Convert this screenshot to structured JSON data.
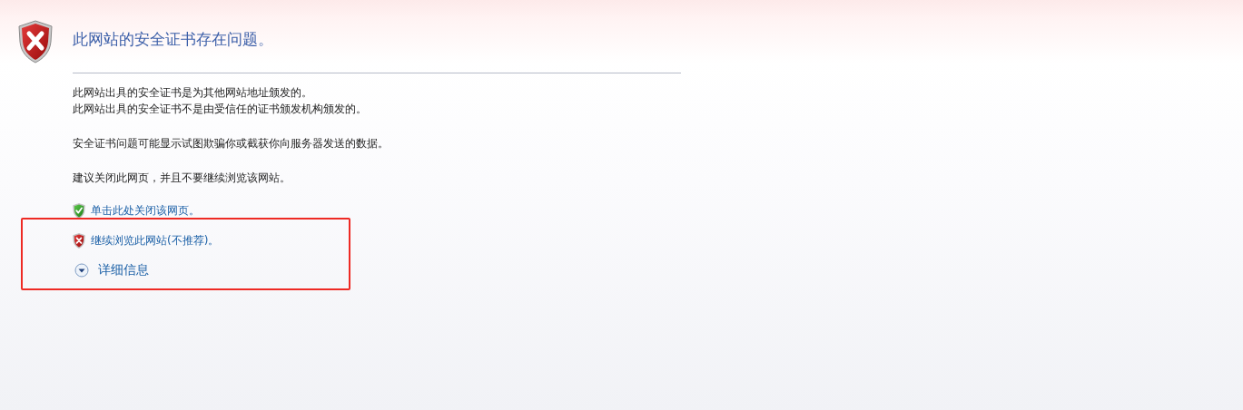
{
  "heading": "此网站的安全证书存在问题。",
  "paragraphs": [
    [
      "此网站出具的安全证书是为其他网站地址颁发的。",
      "此网站出具的安全证书不是由受信任的证书颁发机构颁发的。"
    ],
    [
      "安全证书问题可能显示试图欺骗你或截获你向服务器发送的数据。"
    ],
    [
      "建议关闭此网页，并且不要继续浏览该网站。"
    ]
  ],
  "links": [
    {
      "kind": "safe",
      "label": "单击此处关闭该网页。"
    },
    {
      "kind": "unsafe",
      "label": "继续浏览此网站(不推荐)。"
    }
  ],
  "more_info": {
    "label": "详细信息",
    "expanded": false
  }
}
